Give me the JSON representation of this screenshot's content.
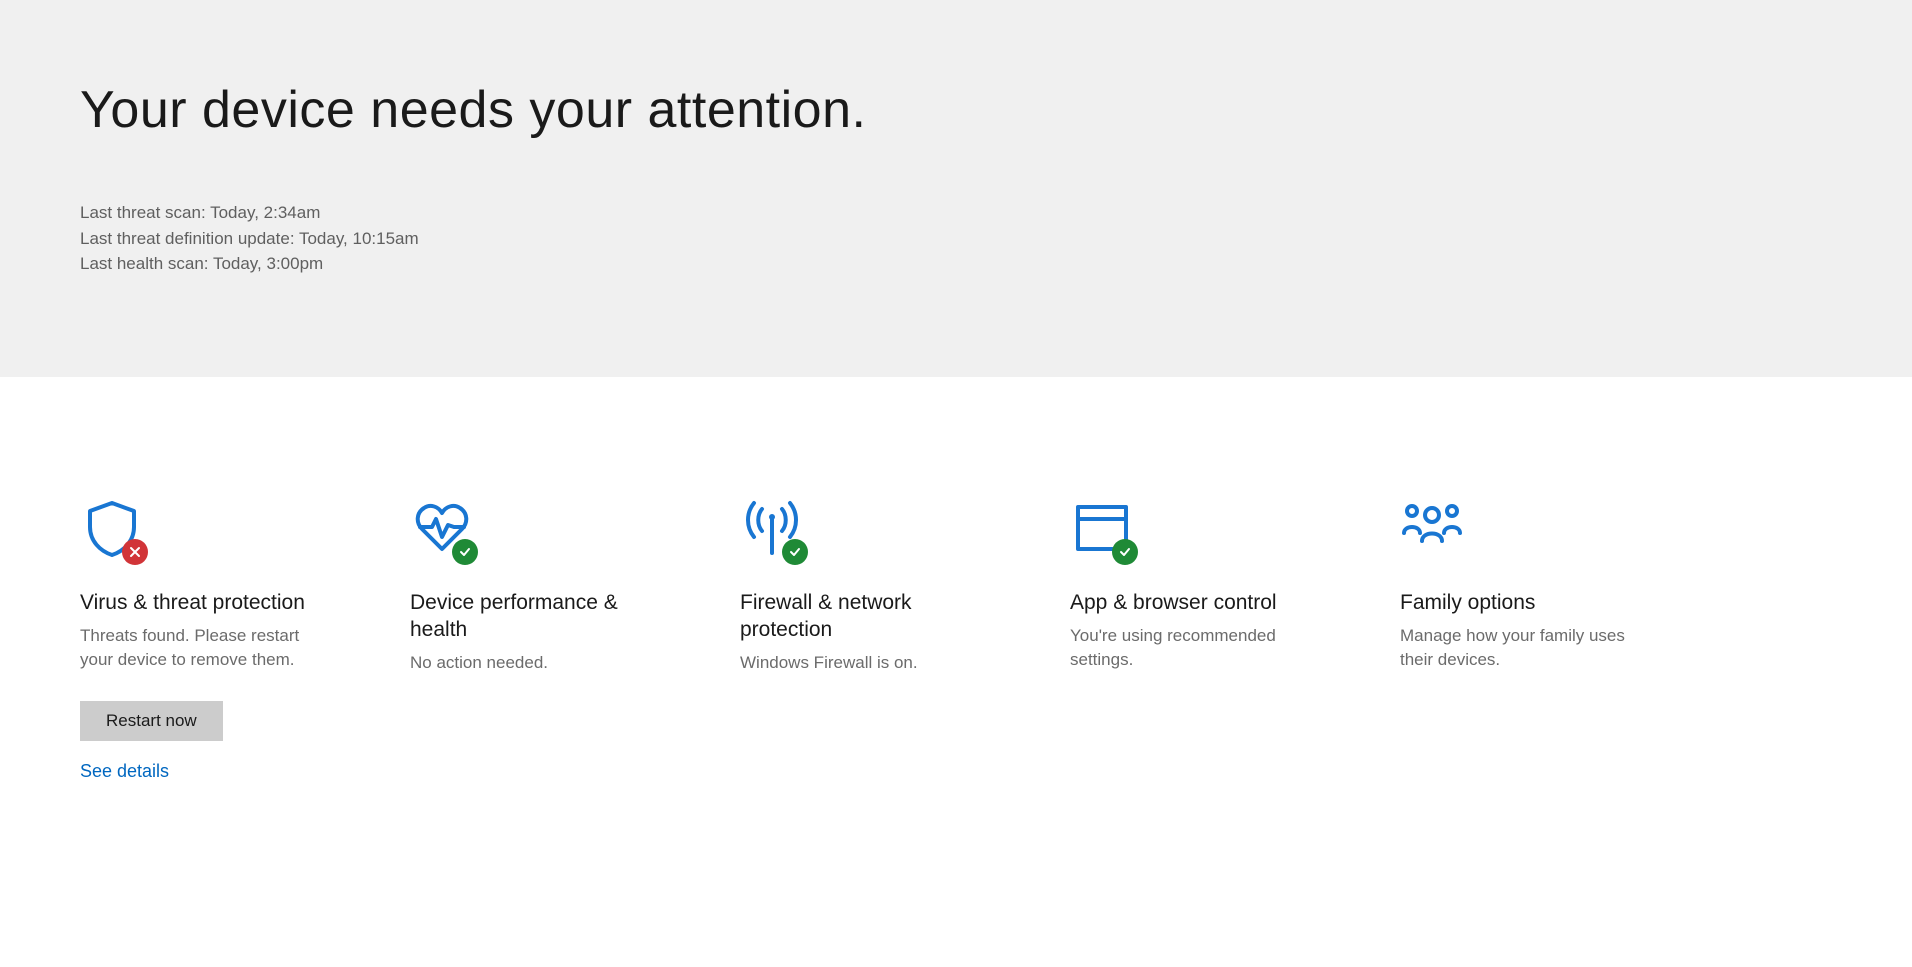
{
  "header": {
    "title": "Your device needs your attention.",
    "status": {
      "last_threat_scan": "Last threat scan: Today, 2:34am",
      "last_definition_update": "Last threat definition update: Today, 10:15am",
      "last_health_scan": "Last health scan: Today, 3:00pm"
    }
  },
  "tiles": {
    "virus": {
      "title": "Virus & threat protection",
      "desc": "Threats found. Please restart your device to remove them.",
      "button_label": "Restart now",
      "link_label": "See details",
      "status": "error"
    },
    "device": {
      "title": "Device performance & health",
      "desc": "No action needed.",
      "status": "ok"
    },
    "firewall": {
      "title": "Firewall & network protection",
      "desc": "Windows Firewall is on.",
      "status": "ok"
    },
    "app": {
      "title": "App & browser control",
      "desc": "You're using recommended settings.",
      "status": "ok"
    },
    "family": {
      "title": "Family options",
      "desc": "Manage how your family uses their devices.",
      "status": "none"
    }
  },
  "colors": {
    "accent_blue": "#1976d2",
    "ok_green": "#1f8a36",
    "error_red": "#d13438",
    "link_blue": "#0067c0"
  }
}
